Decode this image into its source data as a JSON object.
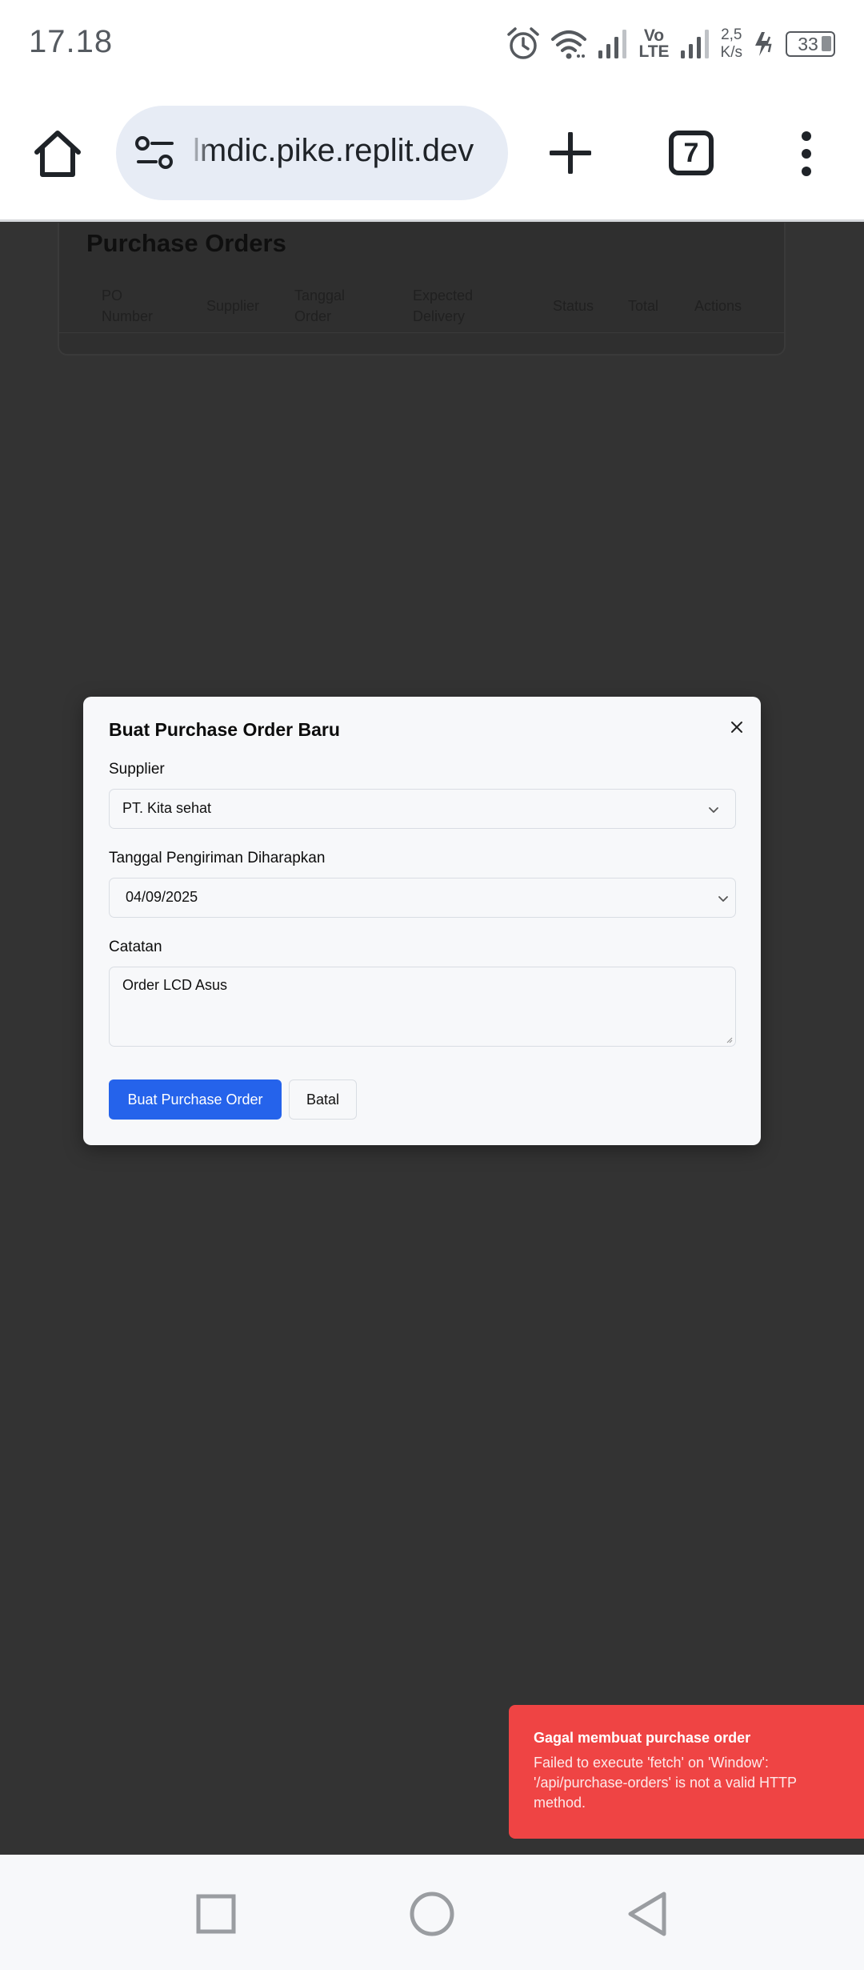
{
  "status_bar": {
    "time": "17.18",
    "network_type": "Vo LTE",
    "network_top": "Vo",
    "network_bottom": "LTE",
    "speed_value": "2,5",
    "speed_unit": "K/s",
    "battery": "33",
    "icons": [
      "alarm-icon",
      "wifi-icon",
      "signal-icon",
      "signal-icon",
      "charging-icon",
      "battery-icon"
    ]
  },
  "browser": {
    "url_display": "lmdic.pike.replit.dev",
    "tab_count": "7",
    "icons": [
      "home-icon",
      "site-settings-icon",
      "new-tab-icon",
      "tab-switcher-icon",
      "more-menu-icon"
    ]
  },
  "background_page": {
    "title": "Purchase Orders",
    "columns": [
      "PO Number",
      "Supplier",
      "Tanggal Order",
      "Expected Delivery",
      "Status",
      "Total",
      "Actions"
    ]
  },
  "modal": {
    "title": "Buat Purchase Order Baru",
    "supplier_label": "Supplier",
    "supplier_value": "PT. Kita sehat",
    "delivery_label": "Tanggal Pengiriman Diharapkan",
    "delivery_value": "04/09/2025",
    "notes_label": "Catatan",
    "notes_value": "Order LCD Asus",
    "submit_label": "Buat Purchase Order",
    "cancel_label": "Batal"
  },
  "toast": {
    "title": "Gagal membuat purchase order",
    "message": "Failed to execute 'fetch' on 'Window': '/api/purchase-orders' is not a valid HTTP method.",
    "color": "#ef4444"
  },
  "colors": {
    "accent": "#2563eb",
    "overlay": "#333333",
    "error": "#ef4444"
  }
}
